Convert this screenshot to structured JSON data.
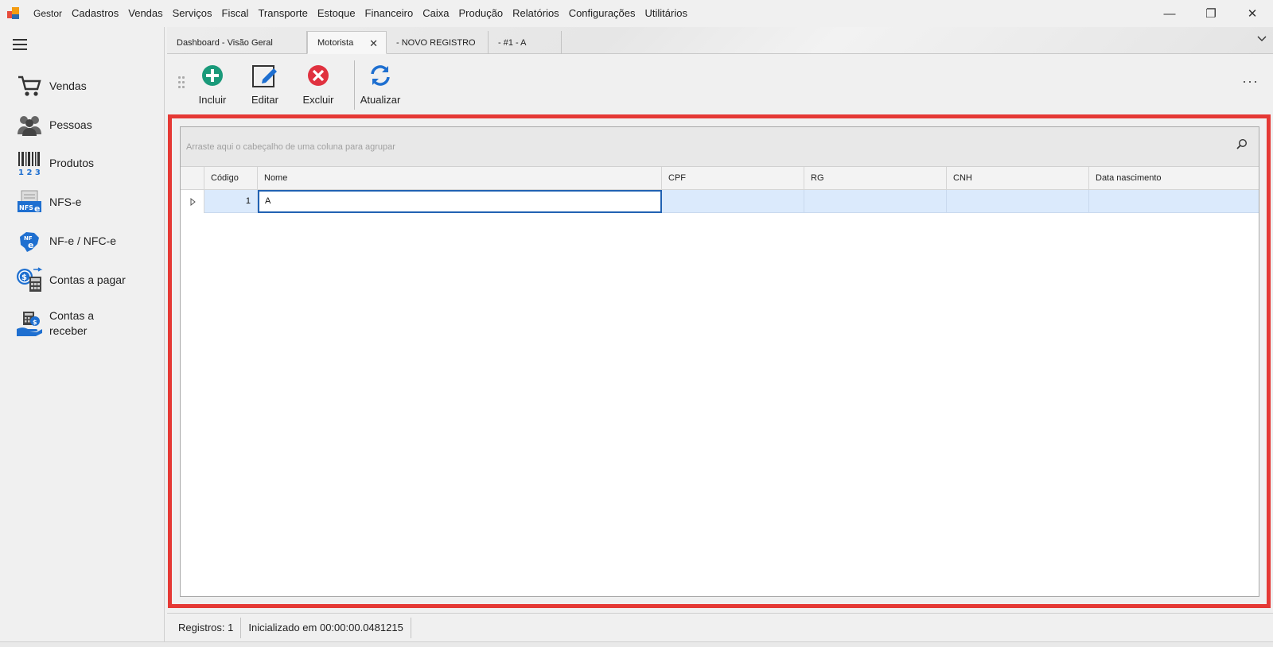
{
  "menubar": {
    "items": [
      "Gestor",
      "Cadastros",
      "Vendas",
      "Serviços",
      "Fiscal",
      "Transporte",
      "Estoque",
      "Financeiro",
      "Caixa",
      "Produção",
      "Relatórios",
      "Configurações",
      "Utilitários"
    ],
    "window_controls": {
      "minimize": "—",
      "restore": "❐",
      "close": "✕"
    }
  },
  "sidebar": {
    "items": [
      {
        "label": "Vendas",
        "icon": "cart-icon"
      },
      {
        "label": "Pessoas",
        "icon": "people-icon"
      },
      {
        "label": "Produtos",
        "icon": "barcode-icon"
      },
      {
        "label": "NFS-e",
        "icon": "nfse-icon"
      },
      {
        "label": "NF-e / NFC-e",
        "icon": "nfe-icon"
      },
      {
        "label": "Contas a pagar",
        "icon": "calculator-money-icon"
      },
      {
        "label": "Contas a\nreceber",
        "icon": "money-hand-icon"
      }
    ]
  },
  "tabs": [
    {
      "label": "Dashboard - Visão Geral",
      "active": false
    },
    {
      "label": "Motorista",
      "active": true,
      "close": "✕"
    },
    {
      "label": "- NOVO REGISTRO",
      "active": false
    },
    {
      "label": "- #1 - A",
      "active": false
    }
  ],
  "toolbar": {
    "buttons": [
      {
        "label": "Incluir",
        "icon": "plus-circle-icon",
        "color": "#1a9a7a"
      },
      {
        "label": "Editar",
        "icon": "edit-icon",
        "color": "#1e6fd0"
      },
      {
        "label": "Excluir",
        "icon": "x-circle-icon",
        "color": "#e0313f"
      },
      {
        "label": "Atualizar",
        "icon": "refresh-icon",
        "color": "#1e6fd0"
      }
    ],
    "more": "···"
  },
  "grid": {
    "group_hint": "Arraste aqui o cabeçalho de uma coluna para agrupar",
    "columns": [
      "Código",
      "Nome",
      "CPF",
      "RG",
      "CNH",
      "Data nascimento"
    ],
    "rows": [
      {
        "codigo": "1",
        "nome": "A",
        "cpf": "",
        "rg": "",
        "cnh": "",
        "data_nascimento": ""
      }
    ]
  },
  "status": {
    "records": "Registros: 1",
    "initialized": "Inicializado em 00:00:00.0481215"
  },
  "colors": {
    "highlight_frame": "#e53935",
    "selected_row": "#dbeafc",
    "focus_border": "#2162b3"
  }
}
